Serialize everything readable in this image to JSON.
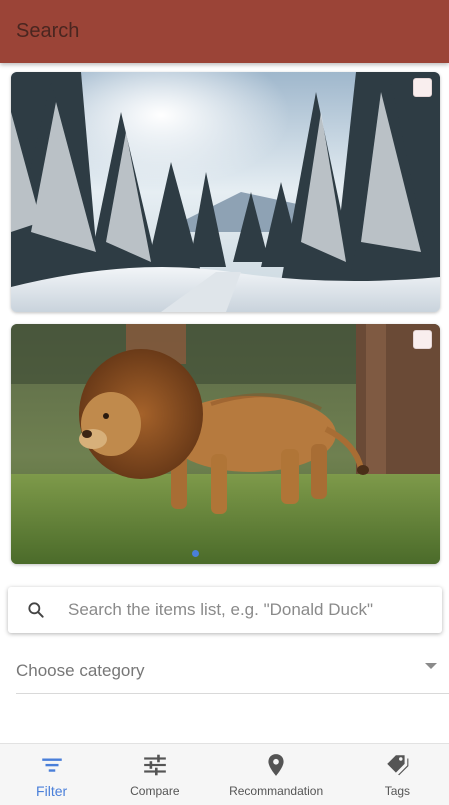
{
  "header": {
    "title": "Search"
  },
  "cards": [
    {
      "image": "snowy-forest-image",
      "selected": false
    },
    {
      "image": "lion-image",
      "selected": false
    }
  ],
  "carousel": {
    "active_index": 0
  },
  "search": {
    "placeholder": "Search the items list, e.g. \"Donald Duck\"",
    "value": ""
  },
  "category": {
    "label": "Choose category"
  },
  "bottom_nav": {
    "items": [
      {
        "label": "Filter",
        "icon": "filter-icon",
        "active": true
      },
      {
        "label": "Compare",
        "icon": "sliders-icon",
        "active": false
      },
      {
        "label": "Recommandation",
        "icon": "location-pin-icon",
        "active": false
      },
      {
        "label": "Tags",
        "icon": "tags-icon",
        "active": false
      }
    ]
  },
  "colors": {
    "appbar": "#9b4437",
    "accent": "#4a7fd9"
  }
}
